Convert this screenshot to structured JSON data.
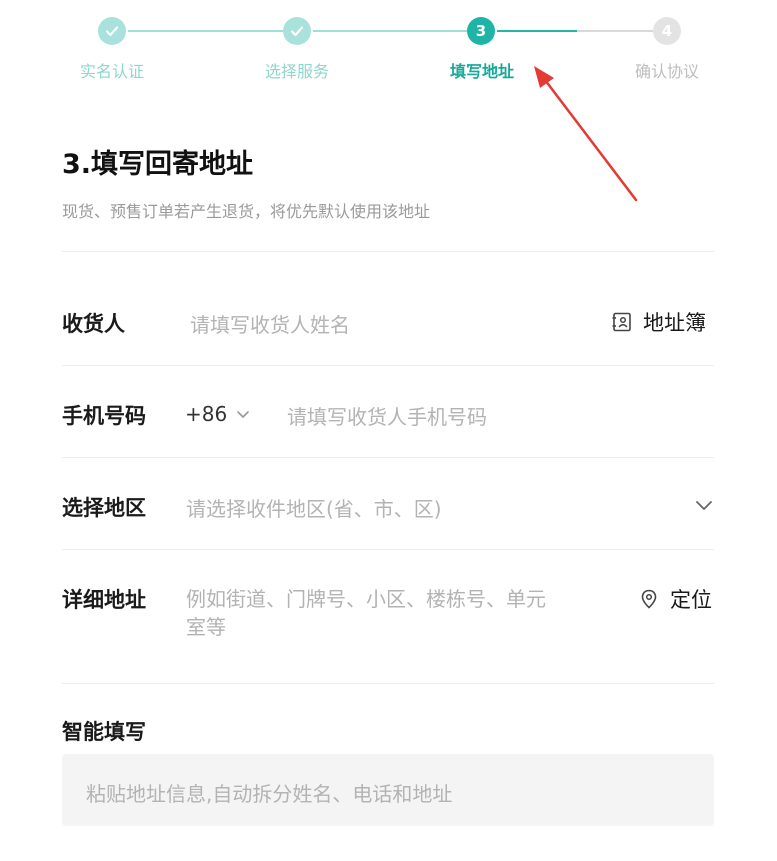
{
  "steps": [
    {
      "label": "实名认证",
      "state": "done"
    },
    {
      "label": "选择服务",
      "state": "done"
    },
    {
      "label": "填写地址",
      "state": "current",
      "number": "3"
    },
    {
      "label": "确认协议",
      "state": "todo",
      "number": "4"
    }
  ],
  "header": {
    "title": "3.填写回寄地址",
    "subtitle": "现货、预售订单若产生退货，将优先默认使用该地址"
  },
  "form": {
    "recipient": {
      "label": "收货人",
      "placeholder": "请填写收货人姓名",
      "action": "地址簿"
    },
    "phone": {
      "label": "手机号码",
      "country_code": "+86",
      "placeholder": "请填写收货人手机号码"
    },
    "region": {
      "label": "选择地区",
      "placeholder": "请选择收件地区(省、市、区)"
    },
    "detail": {
      "label": "详细地址",
      "placeholder_line1": "例如街道、门牌号、小区、楼栋号、单元",
      "placeholder_line2": "室等",
      "action": "定位"
    }
  },
  "smart_fill": {
    "title": "智能填写",
    "placeholder": "粘贴地址信息,自动拆分姓名、电话和地址"
  },
  "colors": {
    "accent": "#1fb5a6",
    "accent_light": "#a8e2da",
    "annotation": "#e53935"
  }
}
